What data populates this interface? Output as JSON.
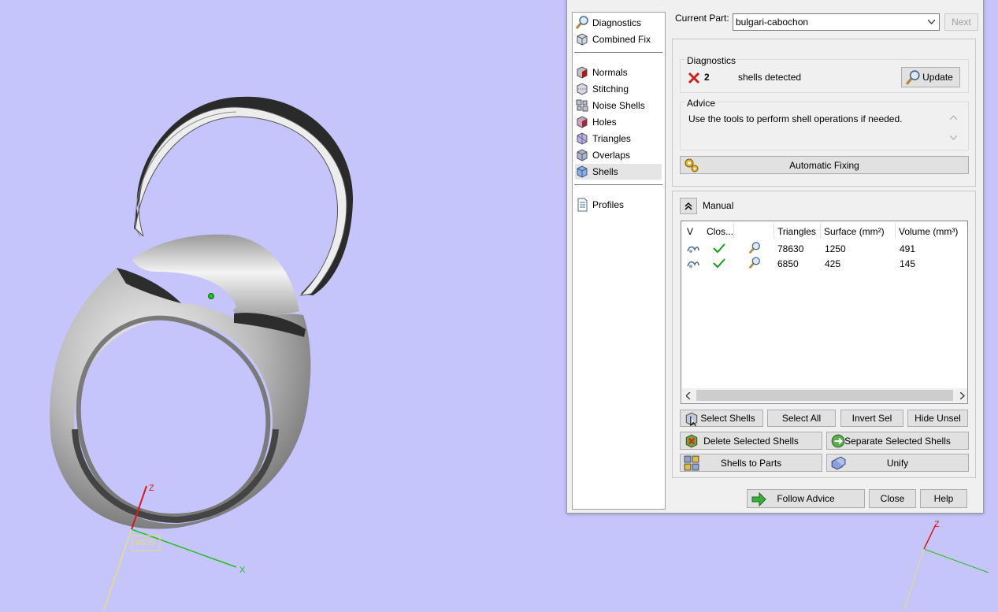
{
  "viewport": {
    "axis_z_left": "Z",
    "axis_x_left": "X",
    "wcs_label": "WCS",
    "axis_z_right": "Z"
  },
  "dialog": {
    "nav": {
      "top_items": [
        {
          "label": "Diagnostics",
          "icon": "magnifier-icon"
        },
        {
          "label": "Combined Fix",
          "icon": "cube-icon"
        }
      ],
      "fix_items": [
        {
          "label": "Normals",
          "icon": "normals-icon"
        },
        {
          "label": "Stitching",
          "icon": "stitching-icon"
        },
        {
          "label": "Noise Shells",
          "icon": "noise-shells-icon"
        },
        {
          "label": "Holes",
          "icon": "holes-icon"
        },
        {
          "label": "Triangles",
          "icon": "triangles-icon"
        },
        {
          "label": "Overlaps",
          "icon": "overlaps-icon"
        },
        {
          "label": "Shells",
          "icon": "shells-icon",
          "selected": true
        }
      ],
      "bottom_items": [
        {
          "label": "Profiles",
          "icon": "document-icon"
        }
      ]
    },
    "current_part_label": "Current Part:",
    "current_part_value": "bulgari-cabochon",
    "next_label": "Next",
    "diagnostics": {
      "title": "Diagnostics",
      "count": "2",
      "text": "shells detected",
      "update_label": "Update"
    },
    "advice": {
      "title": "Advice",
      "text": "Use the tools to perform shell operations if needed."
    },
    "automatic_fixing_label": "Automatic Fixing",
    "manual": {
      "label": "Manual",
      "columns": [
        "V",
        "Clos...",
        "",
        "Triangles",
        "Surface (mm²)",
        "Volume (mm³)"
      ],
      "rows": [
        {
          "triangles": "78630",
          "surface": "1250",
          "volume": "491"
        },
        {
          "triangles": "6850",
          "surface": "425",
          "volume": "145"
        }
      ]
    },
    "buttons": {
      "select_shells": "Select Shells",
      "select_all": "Select All",
      "invert_sel": "Invert Sel",
      "hide_unsel": "Hide Unsel",
      "delete_selected": "Delete Selected Shells",
      "separate_selected": "Separate Selected Shells",
      "shells_to_parts": "Shells to Parts",
      "unify": "Unify",
      "follow_advice": "Follow Advice",
      "close": "Close",
      "help": "Help"
    },
    "colors": {
      "viewport_bg": "#c5c5fb",
      "check": "#1a9a1a",
      "error": "#cc2020",
      "axis_z": "#d81818",
      "axis_x": "#1fc01f",
      "axis_y": "#e8e070"
    }
  }
}
